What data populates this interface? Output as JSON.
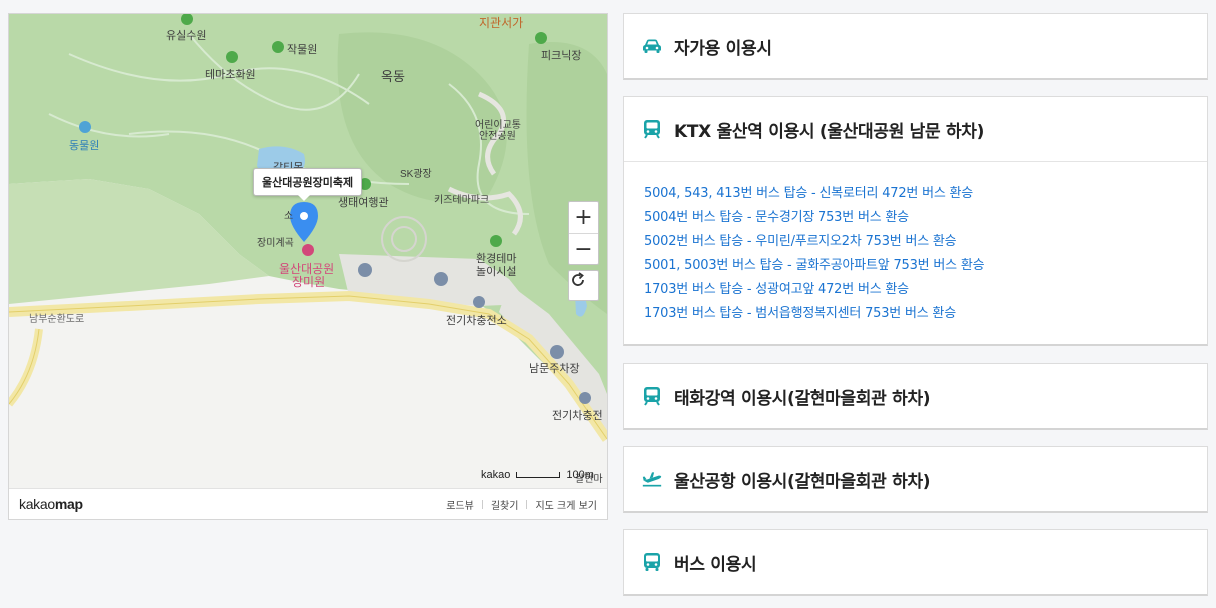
{
  "map": {
    "callout": "울산대공원장미축제",
    "place_labels": {
      "yusilsuwon": "유실수원",
      "jakmulwon": "작물원",
      "temachohwawon": "테마초화원",
      "okdong": "옥동",
      "dongmulwon": "동물원",
      "children_center_line1": "어린이교통",
      "children_center_line2": "안전공원",
      "picnic": "피크닉장",
      "jiganseoga": "지관서가",
      "sk_plaza": "SK광장",
      "kids_theme_park": "키즈테마파크",
      "ecology_hall": "생태여행관",
      "rose_valley": "장미계곡",
      "rose_garden_line1": "울산대공원",
      "rose_garden_line2": "장미원",
      "env_theme_line1": "환경테마",
      "env_theme_line2": "놀이시설",
      "ev_station_1": "전기차충전소",
      "south_gate_parking": "남문주차장",
      "ev_station_2": "전기차충전",
      "road_name": "남부순환도로",
      "partial_top": "갈티못",
      "partial_small": "소",
      "partial_right": "갈현마"
    },
    "scale_brand": "kakao",
    "scale_value": "100m",
    "logo_light": "kakao",
    "logo_bold": "map",
    "footer_links": [
      "로드뷰",
      "길찾기",
      "지도 크게 보기"
    ]
  },
  "panels": [
    {
      "icon": "car-icon",
      "title": "자가용 이용시"
    },
    {
      "icon": "train-icon",
      "title": "KTX 울산역 이용시 (울산대공원 남문 하차)",
      "routes": [
        "5004, 543, 413번 버스 탑승 - 신복로터리 472번 버스 환승",
        "5004번 버스 탑승 - 문수경기장 753번 버스 환승",
        "5002번 버스 탑승 - 우미린/푸르지오2차 753번 버스 환승",
        "5001, 5003번 버스 탑승 - 굴화주공아파트앞 753번 버스 환승",
        "1703번 버스 탑승 - 성광여고앞 472번 버스 환승",
        "1703번 버스 탑승 - 범서읍행정복지센터 753번 버스 환승"
      ]
    },
    {
      "icon": "train-icon",
      "title": "태화강역 이용시(갈현마을회관 하차)"
    },
    {
      "icon": "airplane-icon",
      "title": "울산공항 이용시(갈현마을회관 하차)"
    },
    {
      "icon": "bus-icon",
      "title": "버스 이용시"
    }
  ],
  "colors": {
    "accent": "#1aa3a8",
    "link": "#1a73d1"
  }
}
